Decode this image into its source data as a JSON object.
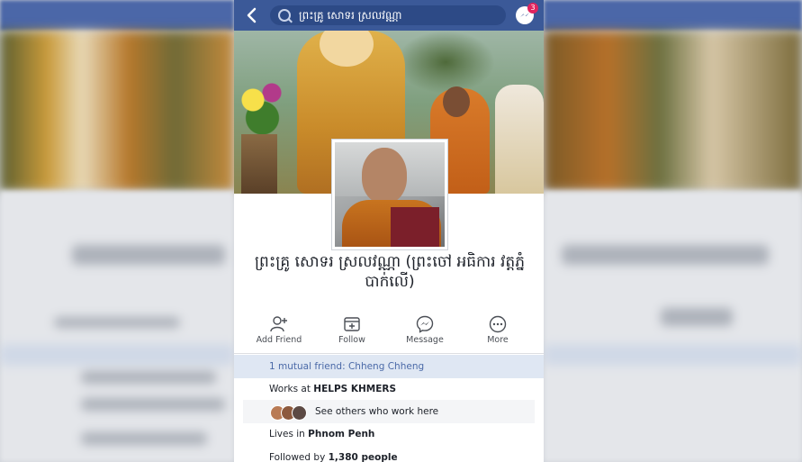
{
  "search": {
    "query": "ព្រះគ្រូ សោទរ ស្រលវណ្ណា"
  },
  "messenger": {
    "badge": "3"
  },
  "profile": {
    "name": "ព្រះគ្រូ សោទរ ស្រលវណ្ណា (ព្រះចៅ អធិការ វត្តភ្នំបាក់លើ)"
  },
  "actions": [
    {
      "label": "Add Friend",
      "icon": "add-friend-icon"
    },
    {
      "label": "Follow",
      "icon": "follow-icon"
    },
    {
      "label": "Message",
      "icon": "messenger-icon"
    },
    {
      "label": "More",
      "icon": "more-icon"
    }
  ],
  "intro": {
    "mutual_prefix": "1 mutual friend: ",
    "mutual_name": "Chheng Chheng",
    "works_prefix": "Works at ",
    "works_place": "HELPS KHMERS",
    "see_others": "See others who work here",
    "lives_prefix": "Lives in ",
    "lives_place": "Phnom Penh",
    "followed_prefix": "Followed by ",
    "followed_count": "1,380 people"
  },
  "colors": {
    "header": "#3b5998",
    "link": "#4b6aa8",
    "monk_robe": "#c8741f"
  }
}
